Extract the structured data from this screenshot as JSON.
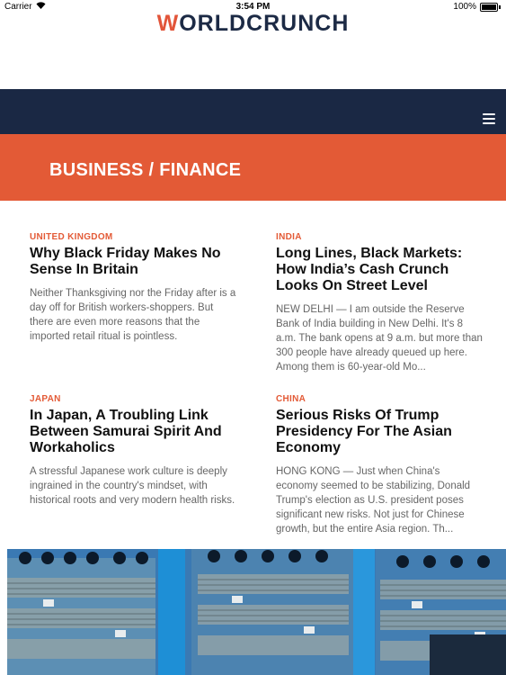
{
  "status_bar": {
    "carrier": "Carrier",
    "time": "3:54 PM",
    "battery": "100%"
  },
  "logo": {
    "accent_letter": "W",
    "rest": "ORLDCRUNCH"
  },
  "section": {
    "title": "BUSINESS / FINANCE"
  },
  "articles": [
    {
      "tag": "UNITED KINGDOM",
      "headline": "Why Black Friday Makes No Sense In Britain",
      "excerpt": "Neither Thanksgiving nor the Friday after is a day off for British workers-shoppers. But there are even more reasons that the imported retail ritual is pointless."
    },
    {
      "tag": "INDIA",
      "headline": "Long Lines, Black Markets: How India’s Cash Crunch Looks On Street Level",
      "excerpt": "NEW DELHI — I am outside the Reserve Bank of India building in New Delhi. It's 8 a.m. The bank opens at 9 a.m. but more than 300 people have already queued up here. Among them is 60-year-old Mo..."
    },
    {
      "tag": "JAPAN",
      "headline": "In Japan, A Troubling Link Between Samurai Spirit And Workaholics",
      "excerpt": "A stressful Japanese work culture is deeply ingrained in the country's mindset, with historical roots and very modern health risks."
    },
    {
      "tag": "CHINA",
      "headline": "Serious Risks Of Trump Presidency For The Asian Economy",
      "excerpt": "HONG KONG — Just when China's economy seemed to be stabilizing, Donald Trump's election as U.S. president poses significant new risks. Not just for Chinese growth, but the entire Asia region. Th..."
    }
  ],
  "colors": {
    "navy": "#1a2844",
    "accent": "#e35a36"
  }
}
